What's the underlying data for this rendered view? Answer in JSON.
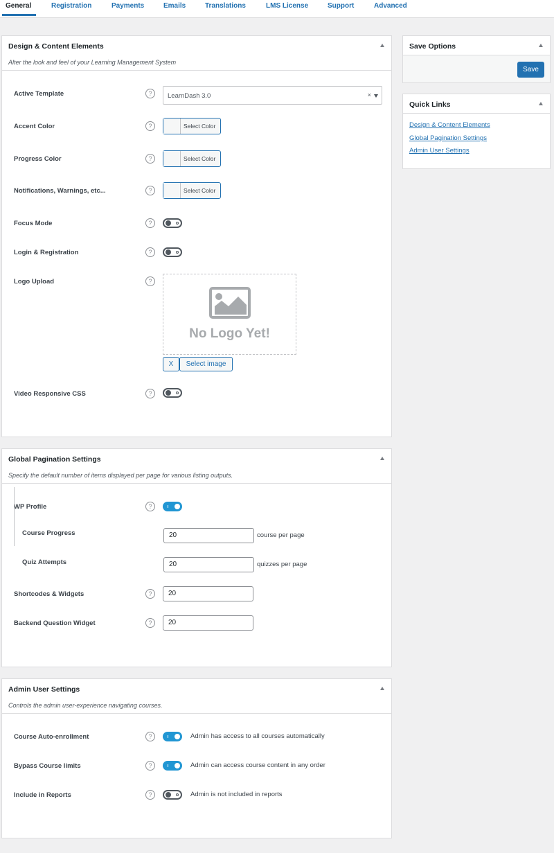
{
  "tabs": [
    {
      "label": "General",
      "active": true
    },
    {
      "label": "Registration"
    },
    {
      "label": "Payments"
    },
    {
      "label": "Emails"
    },
    {
      "label": "Translations"
    },
    {
      "label": "LMS License"
    },
    {
      "label": "Support"
    },
    {
      "label": "Advanced"
    }
  ],
  "design": {
    "title": "Design & Content Elements",
    "description": "Alter the look and feel of your Learning Management System",
    "active_template": {
      "label": "Active Template",
      "value": "LearnDash 3.0",
      "clear": "×"
    },
    "accent_color": {
      "label": "Accent Color",
      "button": "Select Color"
    },
    "progress_color": {
      "label": "Progress Color",
      "button": "Select Color"
    },
    "notifications_color": {
      "label": "Notifications, Warnings, etc...",
      "button": "Select Color"
    },
    "focus_mode": {
      "label": "Focus Mode",
      "enabled": false
    },
    "login_registration": {
      "label": "Login & Registration",
      "enabled": false
    },
    "logo_upload": {
      "label": "Logo Upload",
      "placeholder": "No Logo Yet!",
      "remove_button": "X",
      "select_button": "Select image"
    },
    "video_responsive": {
      "label": "Video Responsive CSS",
      "enabled": false
    }
  },
  "pagination": {
    "title": "Global Pagination Settings",
    "description": "Specify the default number of items displayed per page for various listing outputs.",
    "wp_profile": {
      "label": "WP Profile",
      "enabled": true
    },
    "course_progress": {
      "label": "Course Progress",
      "value": "20",
      "suffix": "course per page"
    },
    "quiz_attempts": {
      "label": "Quiz Attempts",
      "value": "20",
      "suffix": "quizzes per page"
    },
    "shortcodes": {
      "label": "Shortcodes & Widgets",
      "value": "20"
    },
    "backend_question": {
      "label": "Backend Question Widget",
      "value": "20"
    }
  },
  "admin": {
    "title": "Admin User Settings",
    "description": "Controls the admin user-experience navigating courses.",
    "auto_enroll": {
      "label": "Course Auto-enrollment",
      "enabled": true,
      "desc": "Admin has access to all courses automatically"
    },
    "bypass": {
      "label": "Bypass Course limits",
      "enabled": true,
      "desc": "Admin can access course content in any order"
    },
    "reports": {
      "label": "Include in Reports",
      "enabled": false,
      "desc": "Admin is not included in reports"
    }
  },
  "save_options": {
    "title": "Save Options",
    "save_label": "Save"
  },
  "quick_links": {
    "title": "Quick Links",
    "links": [
      "Design & Content Elements",
      "Global Pagination Settings",
      "Admin User Settings"
    ]
  },
  "help_glyph": "?",
  "colors": {
    "accent": "#2271b1",
    "toggle_on": "#2196d3"
  }
}
